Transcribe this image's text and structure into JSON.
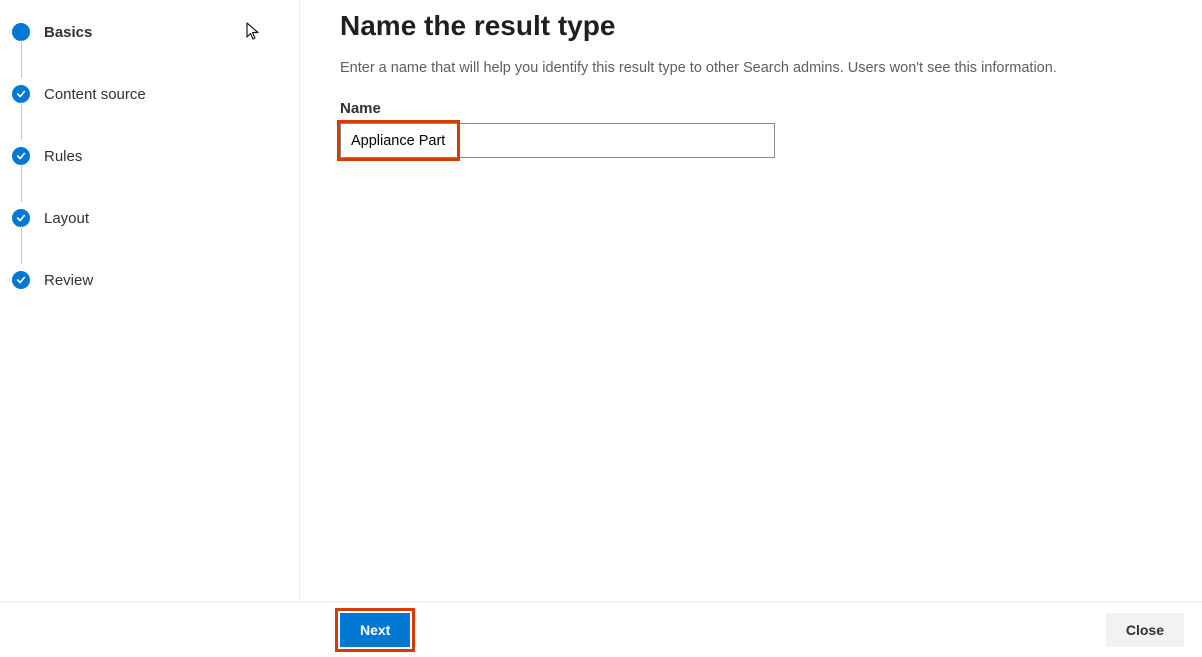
{
  "sidebar": {
    "steps": [
      {
        "label": "Basics",
        "state": "current"
      },
      {
        "label": "Content source",
        "state": "completed"
      },
      {
        "label": "Rules",
        "state": "completed"
      },
      {
        "label": "Layout",
        "state": "completed"
      },
      {
        "label": "Review",
        "state": "completed"
      }
    ]
  },
  "main": {
    "title": "Name the result type",
    "description": "Enter a name that will help you identify this result type to other Search admins. Users won't see this information.",
    "name_label": "Name",
    "name_value": "Appliance Part"
  },
  "footer": {
    "next_label": "Next",
    "close_label": "Close"
  },
  "colors": {
    "accent": "#0078d4",
    "highlight": "#d83b01"
  }
}
